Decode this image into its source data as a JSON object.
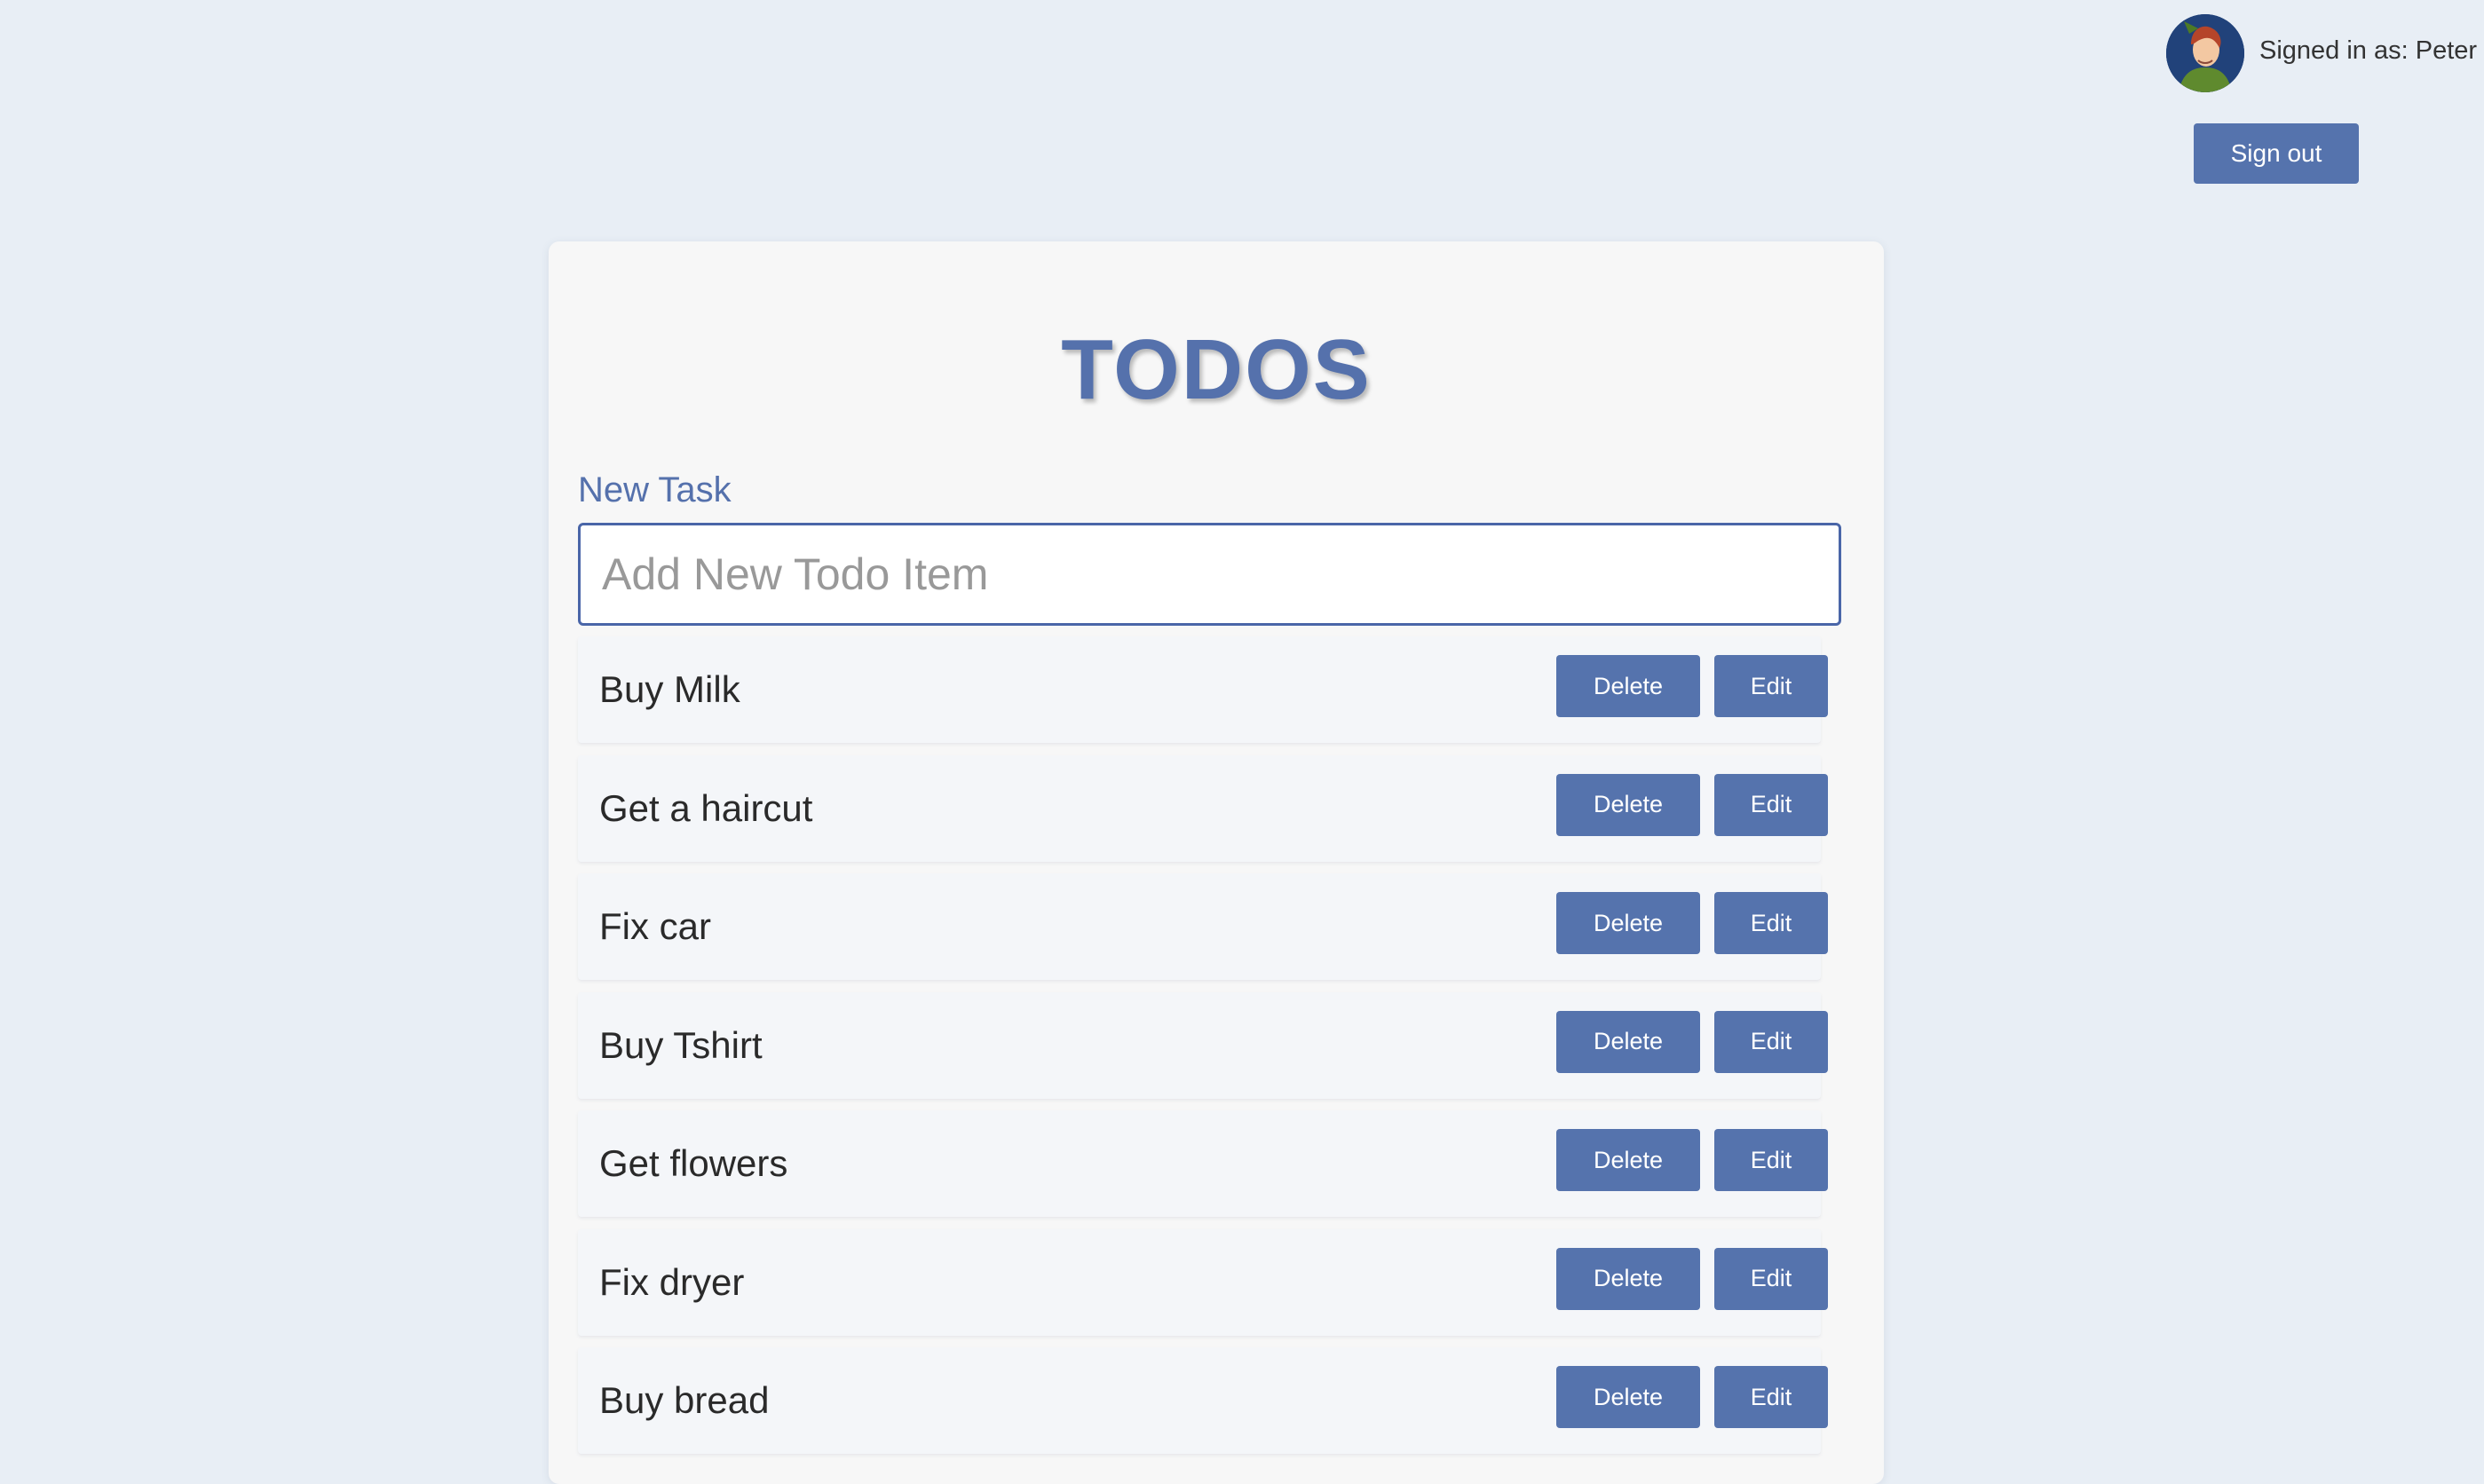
{
  "user": {
    "signed_in_text": "Signed in as: Peter",
    "avatar_icon": "user-avatar-icon",
    "sign_out_label": "Sign out"
  },
  "app": {
    "title": "TODOS"
  },
  "new_task": {
    "label": "New Task",
    "value": "",
    "placeholder": "Add New Todo Item"
  },
  "todos": [
    {
      "text": "Buy Milk",
      "delete_label": "Delete",
      "edit_label": "Edit"
    },
    {
      "text": "Get a haircut",
      "delete_label": "Delete",
      "edit_label": "Edit"
    },
    {
      "text": "Fix car",
      "delete_label": "Delete",
      "edit_label": "Edit"
    },
    {
      "text": "Buy Tshirt",
      "delete_label": "Delete",
      "edit_label": "Edit"
    },
    {
      "text": "Get flowers",
      "delete_label": "Delete",
      "edit_label": "Edit"
    },
    {
      "text": "Fix dryer",
      "delete_label": "Delete",
      "edit_label": "Edit"
    },
    {
      "text": "Buy bread",
      "delete_label": "Delete",
      "edit_label": "Edit"
    }
  ],
  "colors": {
    "page_background": "#e8eef5",
    "accent": "#5573ad",
    "card_background": "#f7f7f7",
    "input_border": "#4a66a8"
  }
}
